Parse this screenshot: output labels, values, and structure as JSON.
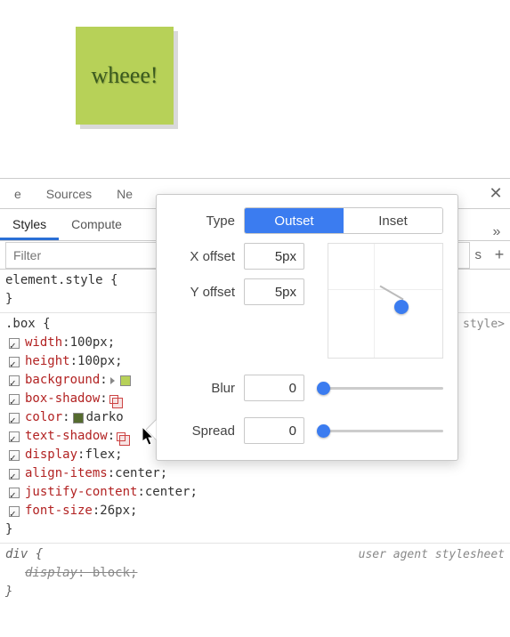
{
  "preview": {
    "text": "wheee!"
  },
  "tabs": {
    "main": [
      "e",
      "Sources",
      "Ne"
    ],
    "sub": [
      "Styles",
      "Compute"
    ],
    "overflow": "»",
    "close": "✕"
  },
  "toolbar": {
    "filter_placeholder": "Filter",
    "right_label": "s",
    "plus": "+"
  },
  "rules": {
    "element": {
      "selector": "element.style {"
    },
    "box": {
      "selector": ".box {",
      "props": [
        {
          "name": "width",
          "value": "100px;"
        },
        {
          "name": "height",
          "value": "100px;"
        },
        {
          "name": "background",
          "value": ""
        },
        {
          "name": "box-shadow",
          "value": ""
        },
        {
          "name": "color",
          "value": "darko"
        },
        {
          "name": "text-shadow",
          "value": ""
        },
        {
          "name": "display",
          "value": "flex;"
        },
        {
          "name": "align-items",
          "value": "center;"
        },
        {
          "name": "justify-content",
          "value": "center;"
        },
        {
          "name": "font-size",
          "value": "26px;"
        }
      ],
      "stylesheet_label": "style>"
    },
    "div": {
      "selector": "div {",
      "prop_name": "display",
      "prop_value": "block;",
      "ua_label": "user agent stylesheet"
    }
  },
  "popover": {
    "type_label": "Type",
    "type_options": [
      "Outset",
      "Inset"
    ],
    "x_label": "X offset",
    "x_value": "5px",
    "y_label": "Y offset",
    "y_value": "5px",
    "blur_label": "Blur",
    "blur_value": "0",
    "spread_label": "Spread",
    "spread_value": "0"
  }
}
